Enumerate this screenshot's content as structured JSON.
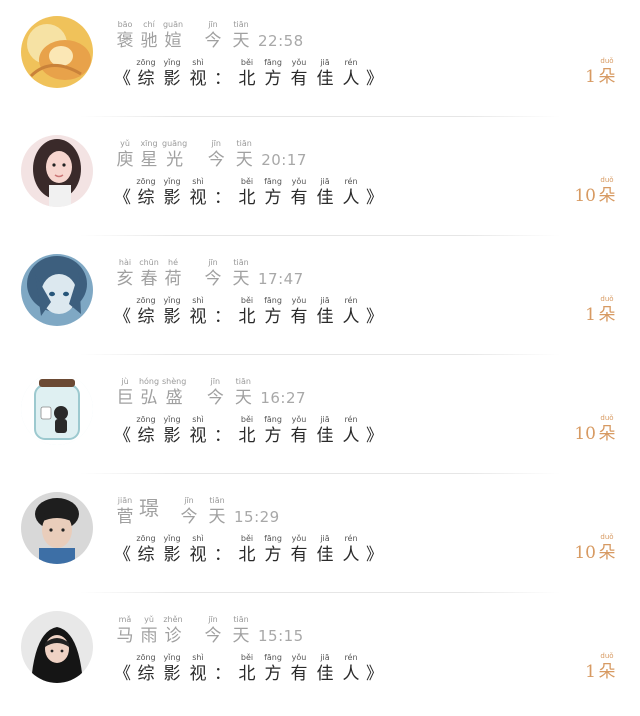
{
  "rows": [
    {
      "name": [
        {
          "py": "bāo",
          "hz": "褒"
        },
        {
          "py": "chí",
          "hz": "驰"
        },
        {
          "py": "guān",
          "hz": "媗"
        }
      ],
      "day": [
        {
          "py": "jīn",
          "hz": "今"
        },
        {
          "py": "tiān",
          "hz": "天"
        }
      ],
      "time": "22:58",
      "count": "1",
      "avatar_icon": "golden-creature-avatar-icon",
      "avatar_colors": [
        "#f0c25a",
        "#e8a24a",
        "#f6e2a4"
      ]
    },
    {
      "name": [
        {
          "py": "yǔ",
          "hz": "庾"
        },
        {
          "py": "xīng",
          "hz": "星"
        },
        {
          "py": "guāng",
          "hz": "光"
        }
      ],
      "day": [
        {
          "py": "jīn",
          "hz": "今"
        },
        {
          "py": "tiān",
          "hz": "天"
        }
      ],
      "time": "20:17",
      "count": "10",
      "avatar_icon": "girl-portrait-avatar-icon",
      "avatar_colors": [
        "#f3e3e3",
        "#3a2a2a",
        "#f7d6cf"
      ]
    },
    {
      "name": [
        {
          "py": "hài",
          "hz": "亥"
        },
        {
          "py": "chūn",
          "hz": "春"
        },
        {
          "py": "hé",
          "hz": "荷"
        }
      ],
      "day": [
        {
          "py": "jīn",
          "hz": "今"
        },
        {
          "py": "tiān",
          "hz": "天"
        }
      ],
      "time": "17:47",
      "count": "1",
      "avatar_icon": "anime-blue-hair-avatar-icon",
      "avatar_colors": [
        "#7fa8c4",
        "#3d5f7e",
        "#dce8ef"
      ]
    },
    {
      "name": [
        {
          "py": "jù",
          "hz": "巨"
        },
        {
          "py": "hóng",
          "hz": "弘"
        },
        {
          "py": "shèng",
          "hz": "盛"
        }
      ],
      "day": [
        {
          "py": "jīn",
          "hz": "今"
        },
        {
          "py": "tiān",
          "hz": "天"
        }
      ],
      "time": "16:27",
      "count": "10",
      "avatar_icon": "jar-figure-avatar-icon",
      "avatar_colors": [
        "#dff0f2",
        "#2a2a2a",
        "#9cc9cf"
      ]
    },
    {
      "name": [
        {
          "py": "jiān",
          "hz": "菅"
        },
        {
          "py": "",
          "hz": "璟"
        }
      ],
      "day": [
        {
          "py": "jīn",
          "hz": "今"
        },
        {
          "py": "tiān",
          "hz": "天"
        }
      ],
      "time": "15:29",
      "count": "10",
      "avatar_icon": "boy-portrait-avatar-icon",
      "avatar_colors": [
        "#d8d8d8",
        "#1e1e1e",
        "#e9cdbb"
      ]
    },
    {
      "name": [
        {
          "py": "mǎ",
          "hz": "马"
        },
        {
          "py": "yǔ",
          "hz": "雨"
        },
        {
          "py": "zhěn",
          "hz": "诊"
        }
      ],
      "day": [
        {
          "py": "jīn",
          "hz": "今"
        },
        {
          "py": "tiān",
          "hz": "天"
        }
      ],
      "time": "15:15",
      "count": "1",
      "avatar_icon": "hooded-boy-avatar-icon",
      "avatar_colors": [
        "#e8e8e8",
        "#151515",
        "#efd2c4"
      ]
    }
  ],
  "message": {
    "open": "《",
    "close": "》",
    "colon": "：",
    "chars": [
      {
        "py": "zōng",
        "hz": "综"
      },
      {
        "py": "yǐng",
        "hz": "影"
      },
      {
        "py": "shì",
        "hz": "视"
      },
      {
        "py": "",
        "hz": ":"
      },
      {
        "py": "běi",
        "hz": "北"
      },
      {
        "py": "fāng",
        "hz": "方"
      },
      {
        "py": "yǒu",
        "hz": "有"
      },
      {
        "py": "jiā",
        "hz": "佳"
      },
      {
        "py": "rén",
        "hz": "人"
      }
    ]
  },
  "unit": {
    "py": "duǒ",
    "hz": "朵"
  }
}
